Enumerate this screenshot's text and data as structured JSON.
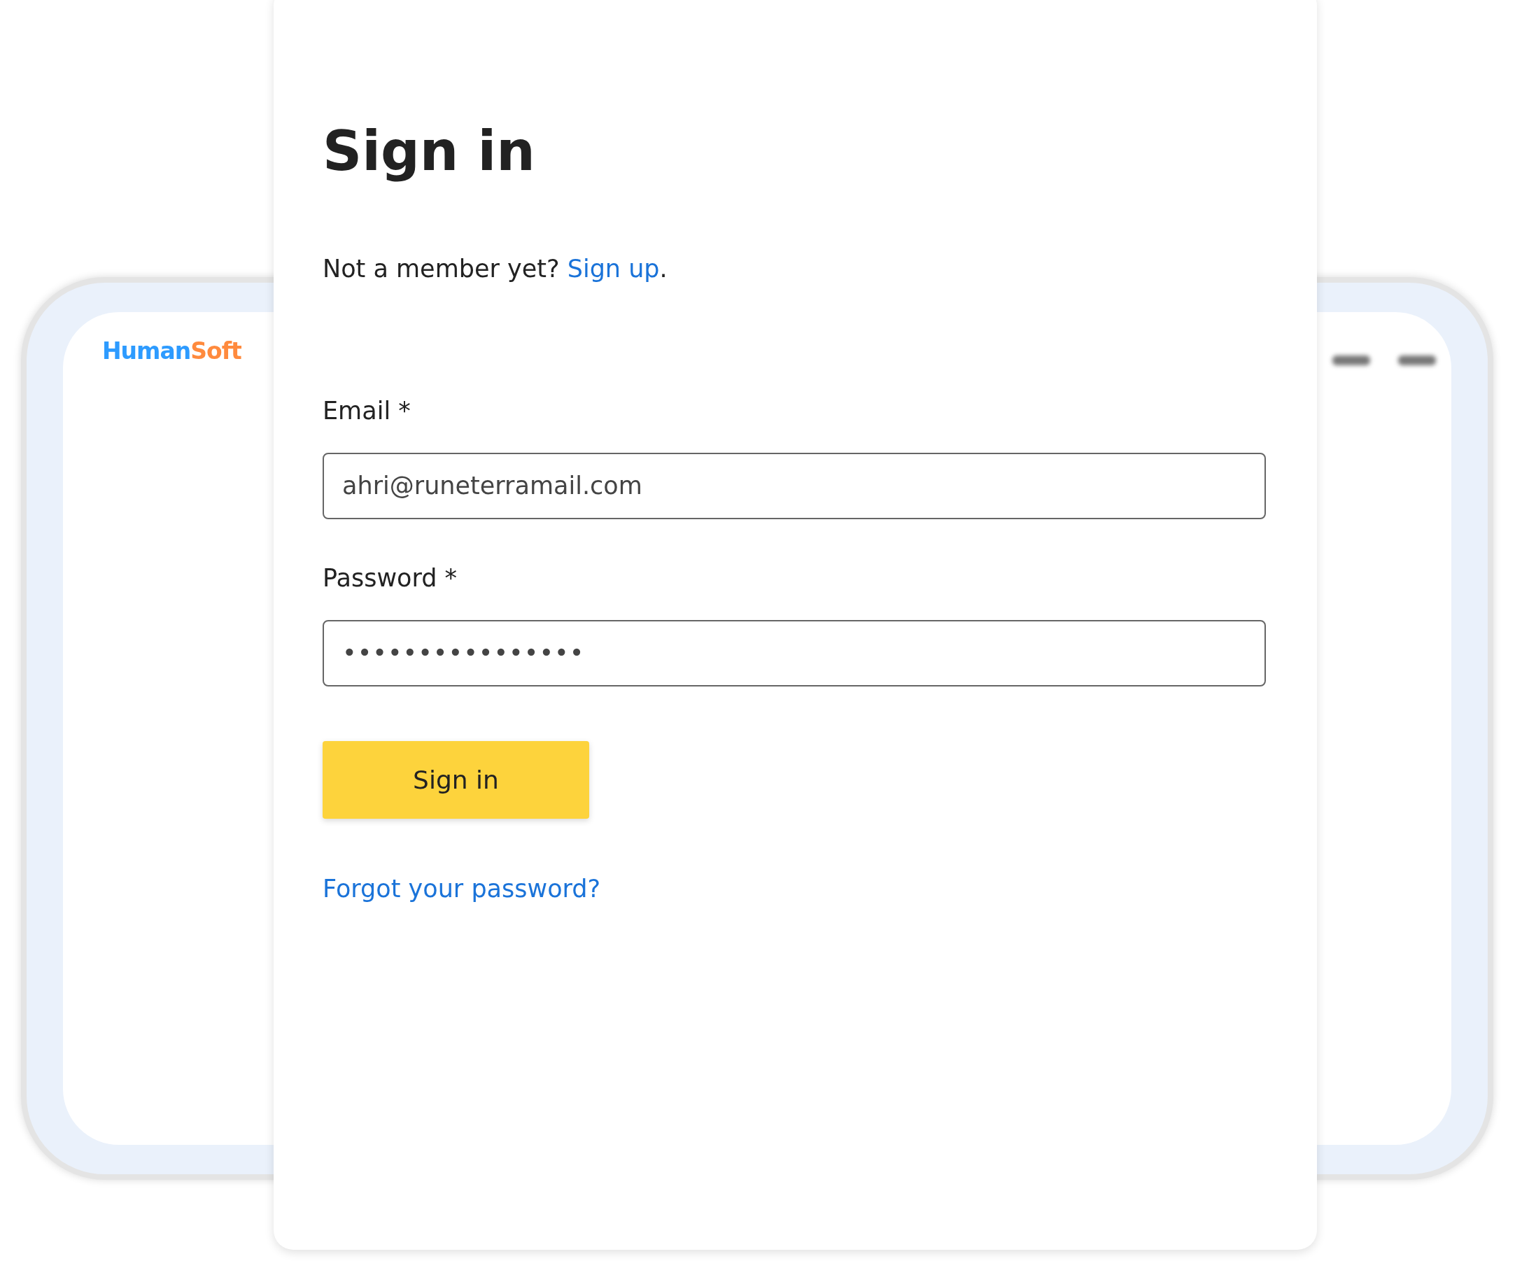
{
  "background_app": {
    "logo": [
      {
        "text": "Human",
        "color": "#2d9bff"
      },
      {
        "text": "Soft",
        "color": "#ff8a3d"
      }
    ]
  },
  "form": {
    "title": "Sign in",
    "signup_prompt": "Not a member yet? ",
    "signup_link": "Sign up",
    "signup_end": ".",
    "fields": [
      {
        "label": "Email *",
        "value": "ahri@runeterramail.com"
      },
      {
        "label": "Password *",
        "value": "••••••••••••••••"
      }
    ],
    "submit": "Sign in",
    "forgot_link": "Forgot your password?"
  }
}
